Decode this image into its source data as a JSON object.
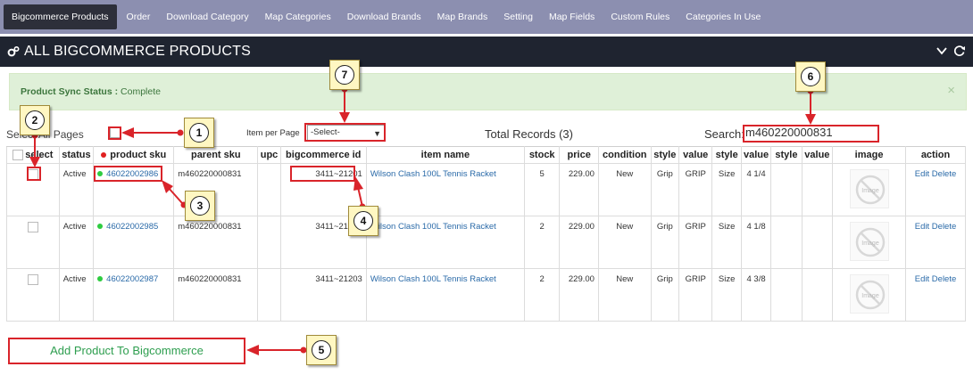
{
  "nav": {
    "items": [
      {
        "label": "Bigcommerce Products",
        "active": true
      },
      {
        "label": "Order"
      },
      {
        "label": "Download Category"
      },
      {
        "label": "Map Categories"
      },
      {
        "label": "Download Brands"
      },
      {
        "label": "Map Brands"
      },
      {
        "label": "Setting"
      },
      {
        "label": "Map Fields"
      },
      {
        "label": "Custom Rules"
      },
      {
        "label": "Categories In Use"
      }
    ]
  },
  "header": {
    "title": "ALL BIGCOMMERCE PRODUCTS",
    "icon": "gears-icon",
    "actions": [
      "chevron-down-icon",
      "refresh-icon"
    ]
  },
  "alert": {
    "label": "Product Sync Status :",
    "status": "Complete",
    "close": "×"
  },
  "toolbar": {
    "select_all_label": "Select All Pages",
    "items_per_page_label": "Item per Page",
    "items_per_page_value": "-Select-",
    "total_records": "Total Records (3)",
    "search_label": "Search:",
    "search_value": "m460220000831"
  },
  "table": {
    "columns": [
      "select",
      "status",
      "product sku",
      "parent sku",
      "upc",
      "bigcommerce id",
      "item name",
      "stock",
      "price",
      "condition",
      "style",
      "value",
      "style",
      "value",
      "style",
      "value",
      "image",
      "action"
    ],
    "rows": [
      {
        "status": "Active",
        "product_sku": "46022002986",
        "parent_sku": "m460220000831",
        "upc": "",
        "bigcommerce_id": "3411~21201",
        "item_name": "Wilson Clash 100L Tennis Racket",
        "stock": "5",
        "price": "229.00",
        "condition": "New",
        "style1": "Grip",
        "value1": "GRIP",
        "style2": "Size",
        "value2": "4 1/4",
        "style3": "",
        "value3": "",
        "image_placeholder": "Image",
        "edit": "Edit",
        "delete": "Delete"
      },
      {
        "status": "Active",
        "product_sku": "46022002985",
        "parent_sku": "m460220000831",
        "upc": "",
        "bigcommerce_id": "3411~21202",
        "item_name": "Wilson Clash 100L Tennis Racket",
        "stock": "2",
        "price": "229.00",
        "condition": "New",
        "style1": "Grip",
        "value1": "GRIP",
        "style2": "Size",
        "value2": "4 1/8",
        "style3": "",
        "value3": "",
        "image_placeholder": "Image",
        "edit": "Edit",
        "delete": "Delete"
      },
      {
        "status": "Active",
        "product_sku": "46022002987",
        "parent_sku": "m460220000831",
        "upc": "",
        "bigcommerce_id": "3411~21203",
        "item_name": "Wilson Clash 100L Tennis Racket",
        "stock": "2",
        "price": "229.00",
        "condition": "New",
        "style1": "Grip",
        "value1": "GRIP",
        "style2": "Size",
        "value2": "4 3/8",
        "style3": "",
        "value3": "",
        "image_placeholder": "Image",
        "edit": "Edit",
        "delete": "Delete"
      }
    ]
  },
  "add_button": {
    "label": "Add Product To Bigcommerce"
  },
  "callouts": [
    "1",
    "2",
    "3",
    "4",
    "5",
    "6",
    "7"
  ],
  "colors": {
    "nav_bg": "#8c8fb0",
    "header_bg": "#1f2430",
    "alert_bg": "#dff0d8",
    "alert_text": "#3c763d",
    "link": "#2a6aa8",
    "annotation_red": "#d9242a",
    "callout_bg": "#fff7c2",
    "active_dot": "#2ecc40"
  }
}
